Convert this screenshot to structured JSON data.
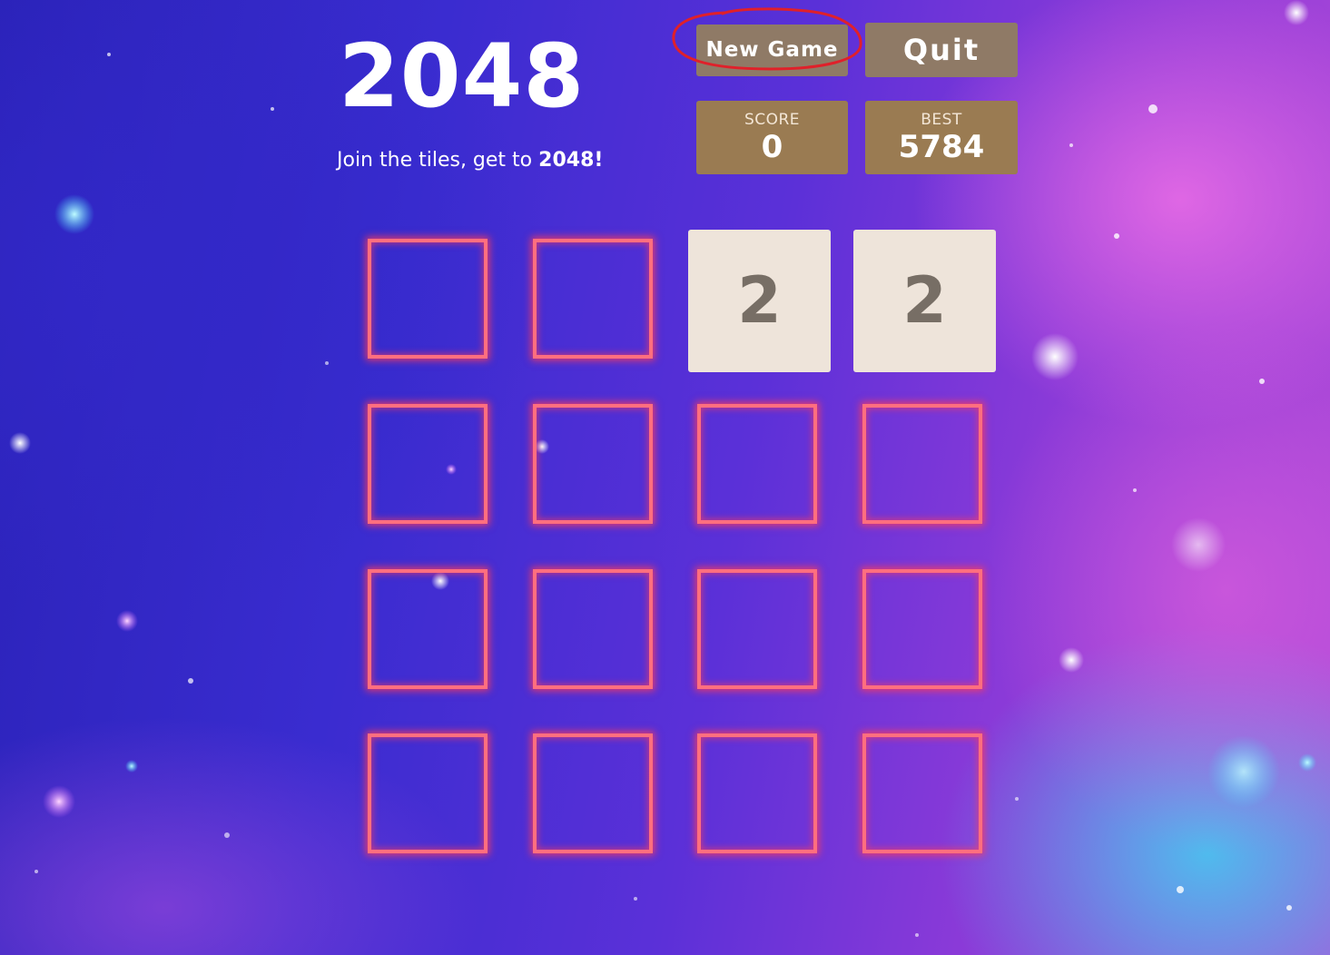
{
  "game": {
    "title": "2048",
    "intro_prefix": "Join the tiles, get to ",
    "intro_target": "2048!"
  },
  "buttons": {
    "new_game": "New Game",
    "quit": "Quit"
  },
  "score": {
    "label": "SCORE",
    "value": "0"
  },
  "best": {
    "label": "BEST",
    "value": "5784"
  },
  "board": {
    "rows": [
      [
        "",
        "",
        "2",
        "2"
      ],
      [
        "",
        "",
        "",
        ""
      ],
      [
        "",
        "",
        "",
        ""
      ],
      [
        "",
        "",
        "",
        ""
      ]
    ]
  },
  "colors": {
    "button_bg": "#8f7a66",
    "score_bg": "#9a7b52",
    "tile_2_bg": "#eee4da",
    "tile_text": "#776e65",
    "cell_outline": "#ff6f7f",
    "annotation": "#e0202a"
  }
}
